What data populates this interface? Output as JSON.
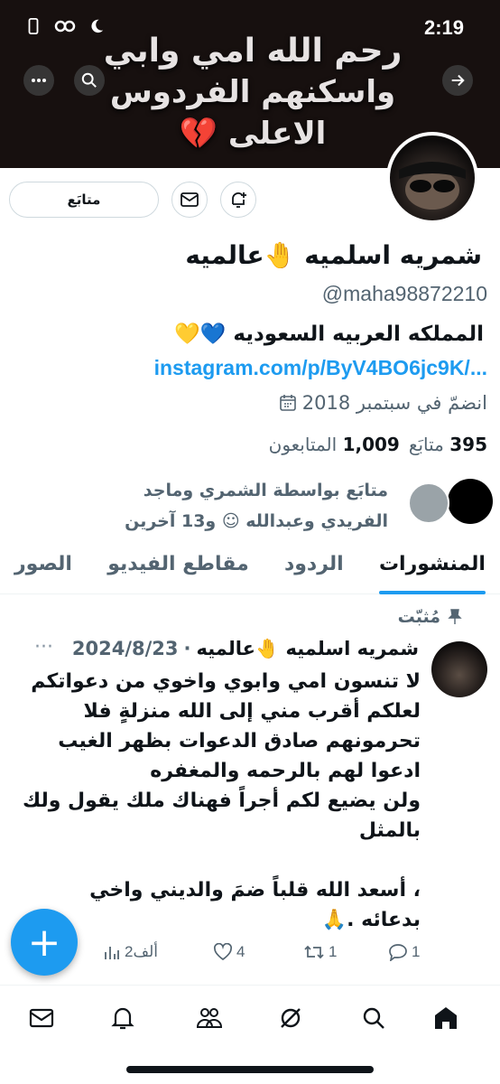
{
  "status_bar": {
    "time": "2:19"
  },
  "banner": {
    "lines": [
      "رحم الله امي وابي",
      "واسكنهم الفردوس",
      "الاعلى 💔"
    ]
  },
  "profile": {
    "follow_label": "متابَع",
    "name": "شمريه اسلميه 🤚عالميه",
    "handle": "@maha98872210",
    "bio": "المملكه العربيه السعوديه 💙💛",
    "link": "instagram.com/p/ByV4BO6jc9K/...",
    "joined": "انضمّ في سبتمبر 2018",
    "following_count": "395",
    "following_label": "متابَع",
    "followers_count": "1,009",
    "followers_label": "المتابعون",
    "followed_by": "متابَع بواسطة الشمري وماجد الفريدي وعبدالله ☺︎ و13 آخرين"
  },
  "tabs": [
    {
      "label": "المنشورات",
      "active": true
    },
    {
      "label": "الردود",
      "active": false
    },
    {
      "label": "مقاطع الفيديو",
      "active": false
    },
    {
      "label": "الصور",
      "active": false
    }
  ],
  "pinned": {
    "label": "مُثبّت",
    "author": "شمريه اسلميه 🤚عالميه",
    "separator": "·",
    "date": "2024/8/23",
    "more": "···",
    "body": "لا تنسون امي وابوي واخوي من دعواتكم\nلعلكم أقرب مني إلى الله منزلةٍ فلا\nتحرمونهم صادق الدعوات بظهر الغيب\nادعوا لهم بالرحمه والمغفره\nولن يضيع لكم أجراً فهناك ملك يقول ولك\nبالمثل\n\n، أسعد الله قلباً ضمَ والديني واخي\nبدعائه .🙏",
    "replies": "1",
    "retweets": "1",
    "likes": "4",
    "views": "2ألف"
  },
  "fab": {
    "label": "+"
  },
  "colors": {
    "accent": "#1d9bf0",
    "text": "#0f1419",
    "muted": "#536471"
  }
}
